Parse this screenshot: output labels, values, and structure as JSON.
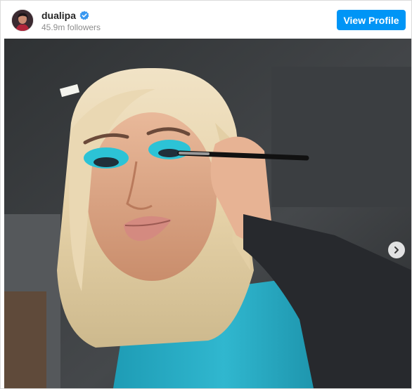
{
  "profile": {
    "username": "dualipa",
    "followers": "45.9m followers",
    "verified": true
  },
  "actions": {
    "view_profile_label": "View Profile"
  },
  "post": {
    "image_subject": "photo",
    "carousel_next_icon": "chevron-right-icon"
  },
  "colors": {
    "accent": "#0095f6",
    "verified_badge": "#3897f0",
    "muted_text": "#8e8e8e"
  }
}
